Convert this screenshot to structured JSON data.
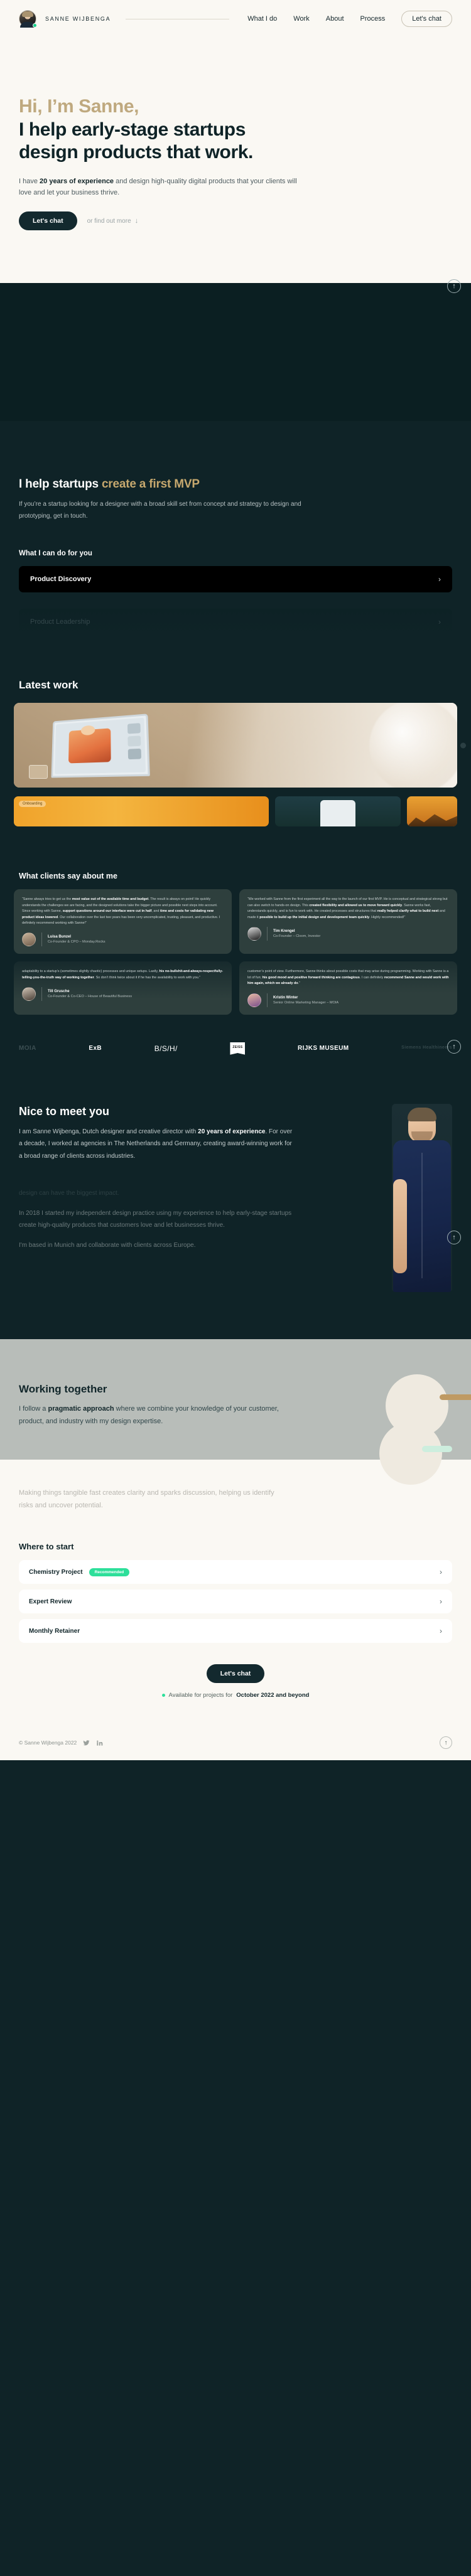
{
  "nav": {
    "brand": "SANNE WIJBENGA",
    "links": [
      "What I do",
      "Work",
      "About",
      "Process"
    ],
    "cta": "Let's chat"
  },
  "hero": {
    "greeting": "Hi, I’m Sanne,",
    "headline_line1": "I help early-stage startups",
    "headline_line2": "design products that work.",
    "intro_a": "I have ",
    "intro_b": "20 years of experience",
    "intro_c": " and design high-quality digital products that your clients will love and let your business thrive.",
    "cta": "Let's chat",
    "secondary": "or find out more",
    "arrow": "↓"
  },
  "mvp": {
    "heading_a": "I help startups ",
    "heading_b": "create a first MVP",
    "lead": "If you’re a startup looking for a designer with a broad skill set from concept and strategy to design and prototyping, get in touch.",
    "subheading": "What I can do for you",
    "services": [
      {
        "label": "Product Discovery",
        "chevron": "›"
      },
      {
        "label": "Product Leadership",
        "chevron": "›"
      }
    ]
  },
  "work": {
    "heading": "Latest work",
    "strip_label": "Onboarding"
  },
  "testimonials": {
    "heading": "What clients say about me",
    "items": [
      {
        "quote_parts": [
          {
            "t": "“Sanne always tries to get us the ",
            "b": false
          },
          {
            "t": "most value out of the available time and budget",
            "b": true
          },
          {
            "t": ". The result is always on point! He quickly understands the challenges we are facing, and the designed solutions take the bigger picture and possible next steps into account. Since working with Sanne, ",
            "b": false
          },
          {
            "t": "support questions around our interface were cut in half",
            "b": true
          },
          {
            "t": ", and ",
            "b": false
          },
          {
            "t": "time and costs for validating new product ideas lowered",
            "b": true
          },
          {
            "t": ". Our collaboration over the last two years has been very uncomplicated, trusting, pleasant, and productive. I definitely recommend working with Sanne!”",
            "b": false
          }
        ],
        "name": "Luisa Bunzel",
        "role": "Co-Founder & CPO – Monday.Rocks"
      },
      {
        "quote_parts": [
          {
            "t": "“We worked with Sanne from the first experiment all the way to the launch of our first MVP. He is conceptual and strategical strong but can also switch to hands-on design. This ",
            "b": false
          },
          {
            "t": "created flexibility and allowed us to move forward quickly",
            "b": true
          },
          {
            "t": ". Sanne works fast, understands quickly, and is fun to work with. He created processes and structures that ",
            "b": false
          },
          {
            "t": "really helped clarify what to build next",
            "b": true
          },
          {
            "t": " and made it ",
            "b": false
          },
          {
            "t": "possible to build up the initial design and development team quickly",
            "b": true
          },
          {
            "t": ". Highly recommended!”",
            "b": false
          }
        ],
        "name": "Tim Krengel",
        "role": "Co-Founder – Cloom, Investor"
      },
      {
        "quote_parts": [
          {
            "t": "adaptability to a startup’s (sometimes slightly chaotic) processes and unique setups. Lastly, ",
            "b": false
          },
          {
            "t": "his no-bullshit-and-always-respectfully-telling-you-the-truth way of working together",
            "b": true
          },
          {
            "t": ". So don’t think twice about it if he has the availability to work with you.”",
            "b": false
          }
        ],
        "name": "Till Grusche",
        "role": "Co-Founder & Co-CEO – House of Beautiful Business"
      },
      {
        "quote_parts": [
          {
            "t": "customer’s point of view. Furthermore, Sanne thinks about possible costs that may arise during programming. Working with Sanne is a lot of fun; ",
            "b": false
          },
          {
            "t": "his good mood and positive forward thinking are contagious",
            "b": true
          },
          {
            "t": ". I can definitely ",
            "b": false
          },
          {
            "t": "recommend Sanne and would work with him again, which we already do",
            "b": true
          },
          {
            "t": ".”",
            "b": false
          }
        ],
        "name": "Kristin Winter",
        "role": "Senior Online Marketing Manager – MOIA"
      }
    ]
  },
  "logos": [
    "MOIA",
    "ExB",
    "B/S/H/",
    "ZEISS",
    "RIJKS MUSEUM",
    "Siemens Healthineers"
  ],
  "about": {
    "heading": "Nice to meet you",
    "p1_a": "I am Sanne Wijbenga, Dutch designer and creative director with ",
    "p1_b": "20 years of experience",
    "p1_c": ". For over a decade, I worked at agencies in The Netherlands and Germany, creating award-winning work for a broad range of clients across industries.",
    "p2": "design can have the biggest impact.",
    "p3": "In 2018 I started my independent design practice using my experience to help early-stage startups create high-quality products that customers love and let businesses thrive.",
    "p4": "I'm based in Munich and collaborate with clients across Europe."
  },
  "working": {
    "heading": "Working together",
    "p_a": "I follow a ",
    "p_b": "pragmatic approach",
    "p_c": " where we combine your knowledge of your customer, product, and industry with my design expertise.",
    "faint": "Making things tangible fast creates clarity and sparks discussion, helping us identify risks and uncover potential."
  },
  "start": {
    "heading": "Where to start",
    "options": [
      {
        "label": "Chemistry Project",
        "badge": "Recommended",
        "chevron": "›"
      },
      {
        "label": "Expert Review",
        "badge": "",
        "chevron": "›"
      },
      {
        "label": "Monthly Retainer",
        "badge": "",
        "chevron": "›"
      }
    ],
    "cta": "Let's chat",
    "availability_a": "Available for projects for ",
    "availability_b": "October 2022 and beyond"
  },
  "footer": {
    "copyright": "© Sanne Wijbenga 2022",
    "scroll_top": "↑"
  },
  "colors": {
    "dark": "#0f2327",
    "cream": "#faf8f3",
    "tan": "#bfa97f",
    "green": "#2ddf9a",
    "grey": "#b8bdb9"
  }
}
